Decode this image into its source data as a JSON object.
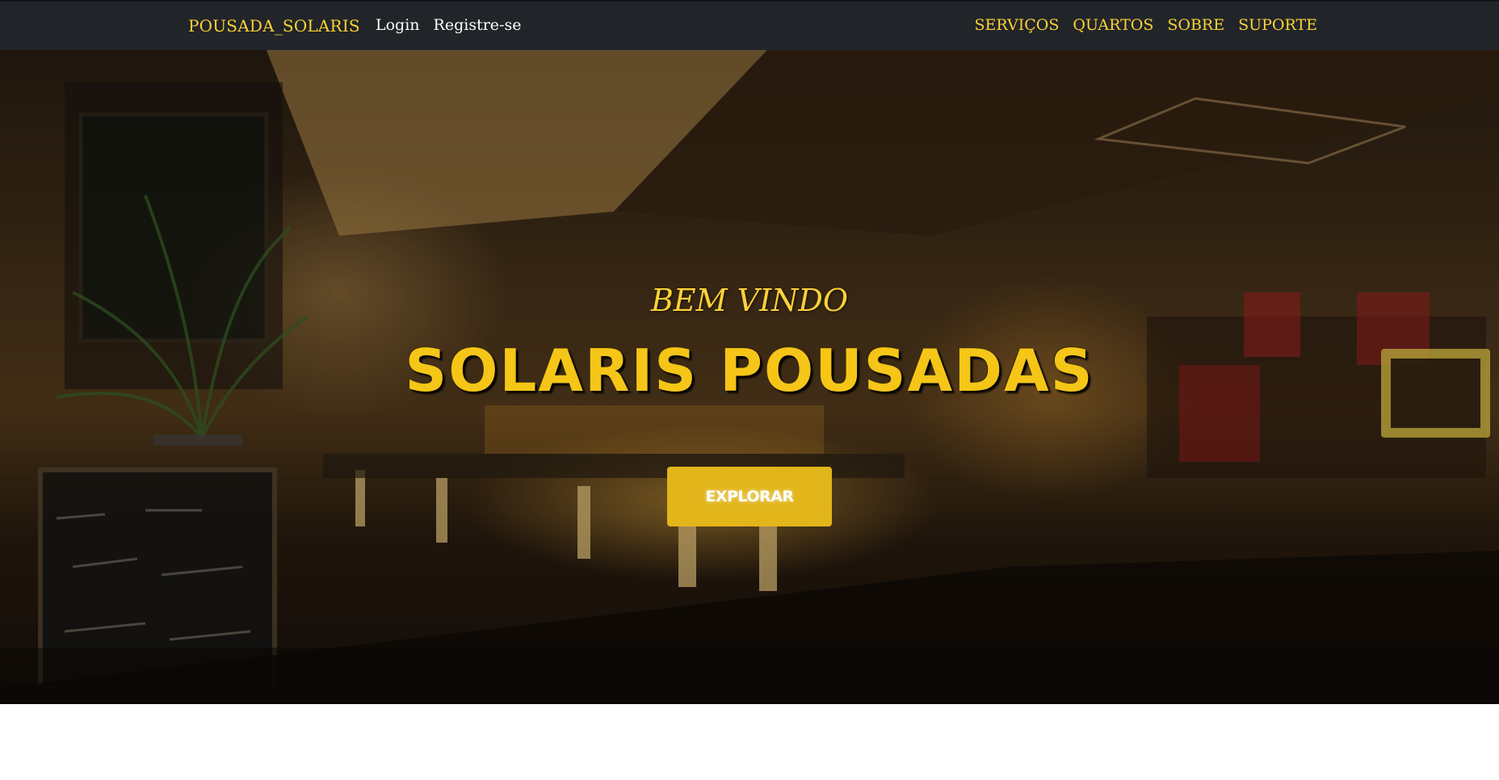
{
  "navbar": {
    "brand": "POUSADA_SOLARIS",
    "left_links": [
      "Login",
      "Registre-se"
    ],
    "right_links": [
      "SERVIÇOS",
      "QUARTOS",
      "SOBRE",
      "SUPORTE"
    ]
  },
  "hero": {
    "subtitle": "BEM VINDO",
    "title": "SOLARIS POUSADAS",
    "button_label": "EXPLORAR"
  },
  "colors": {
    "navbar_bg": "#212529",
    "accent": "#fed136",
    "button": "#e2b51a"
  }
}
